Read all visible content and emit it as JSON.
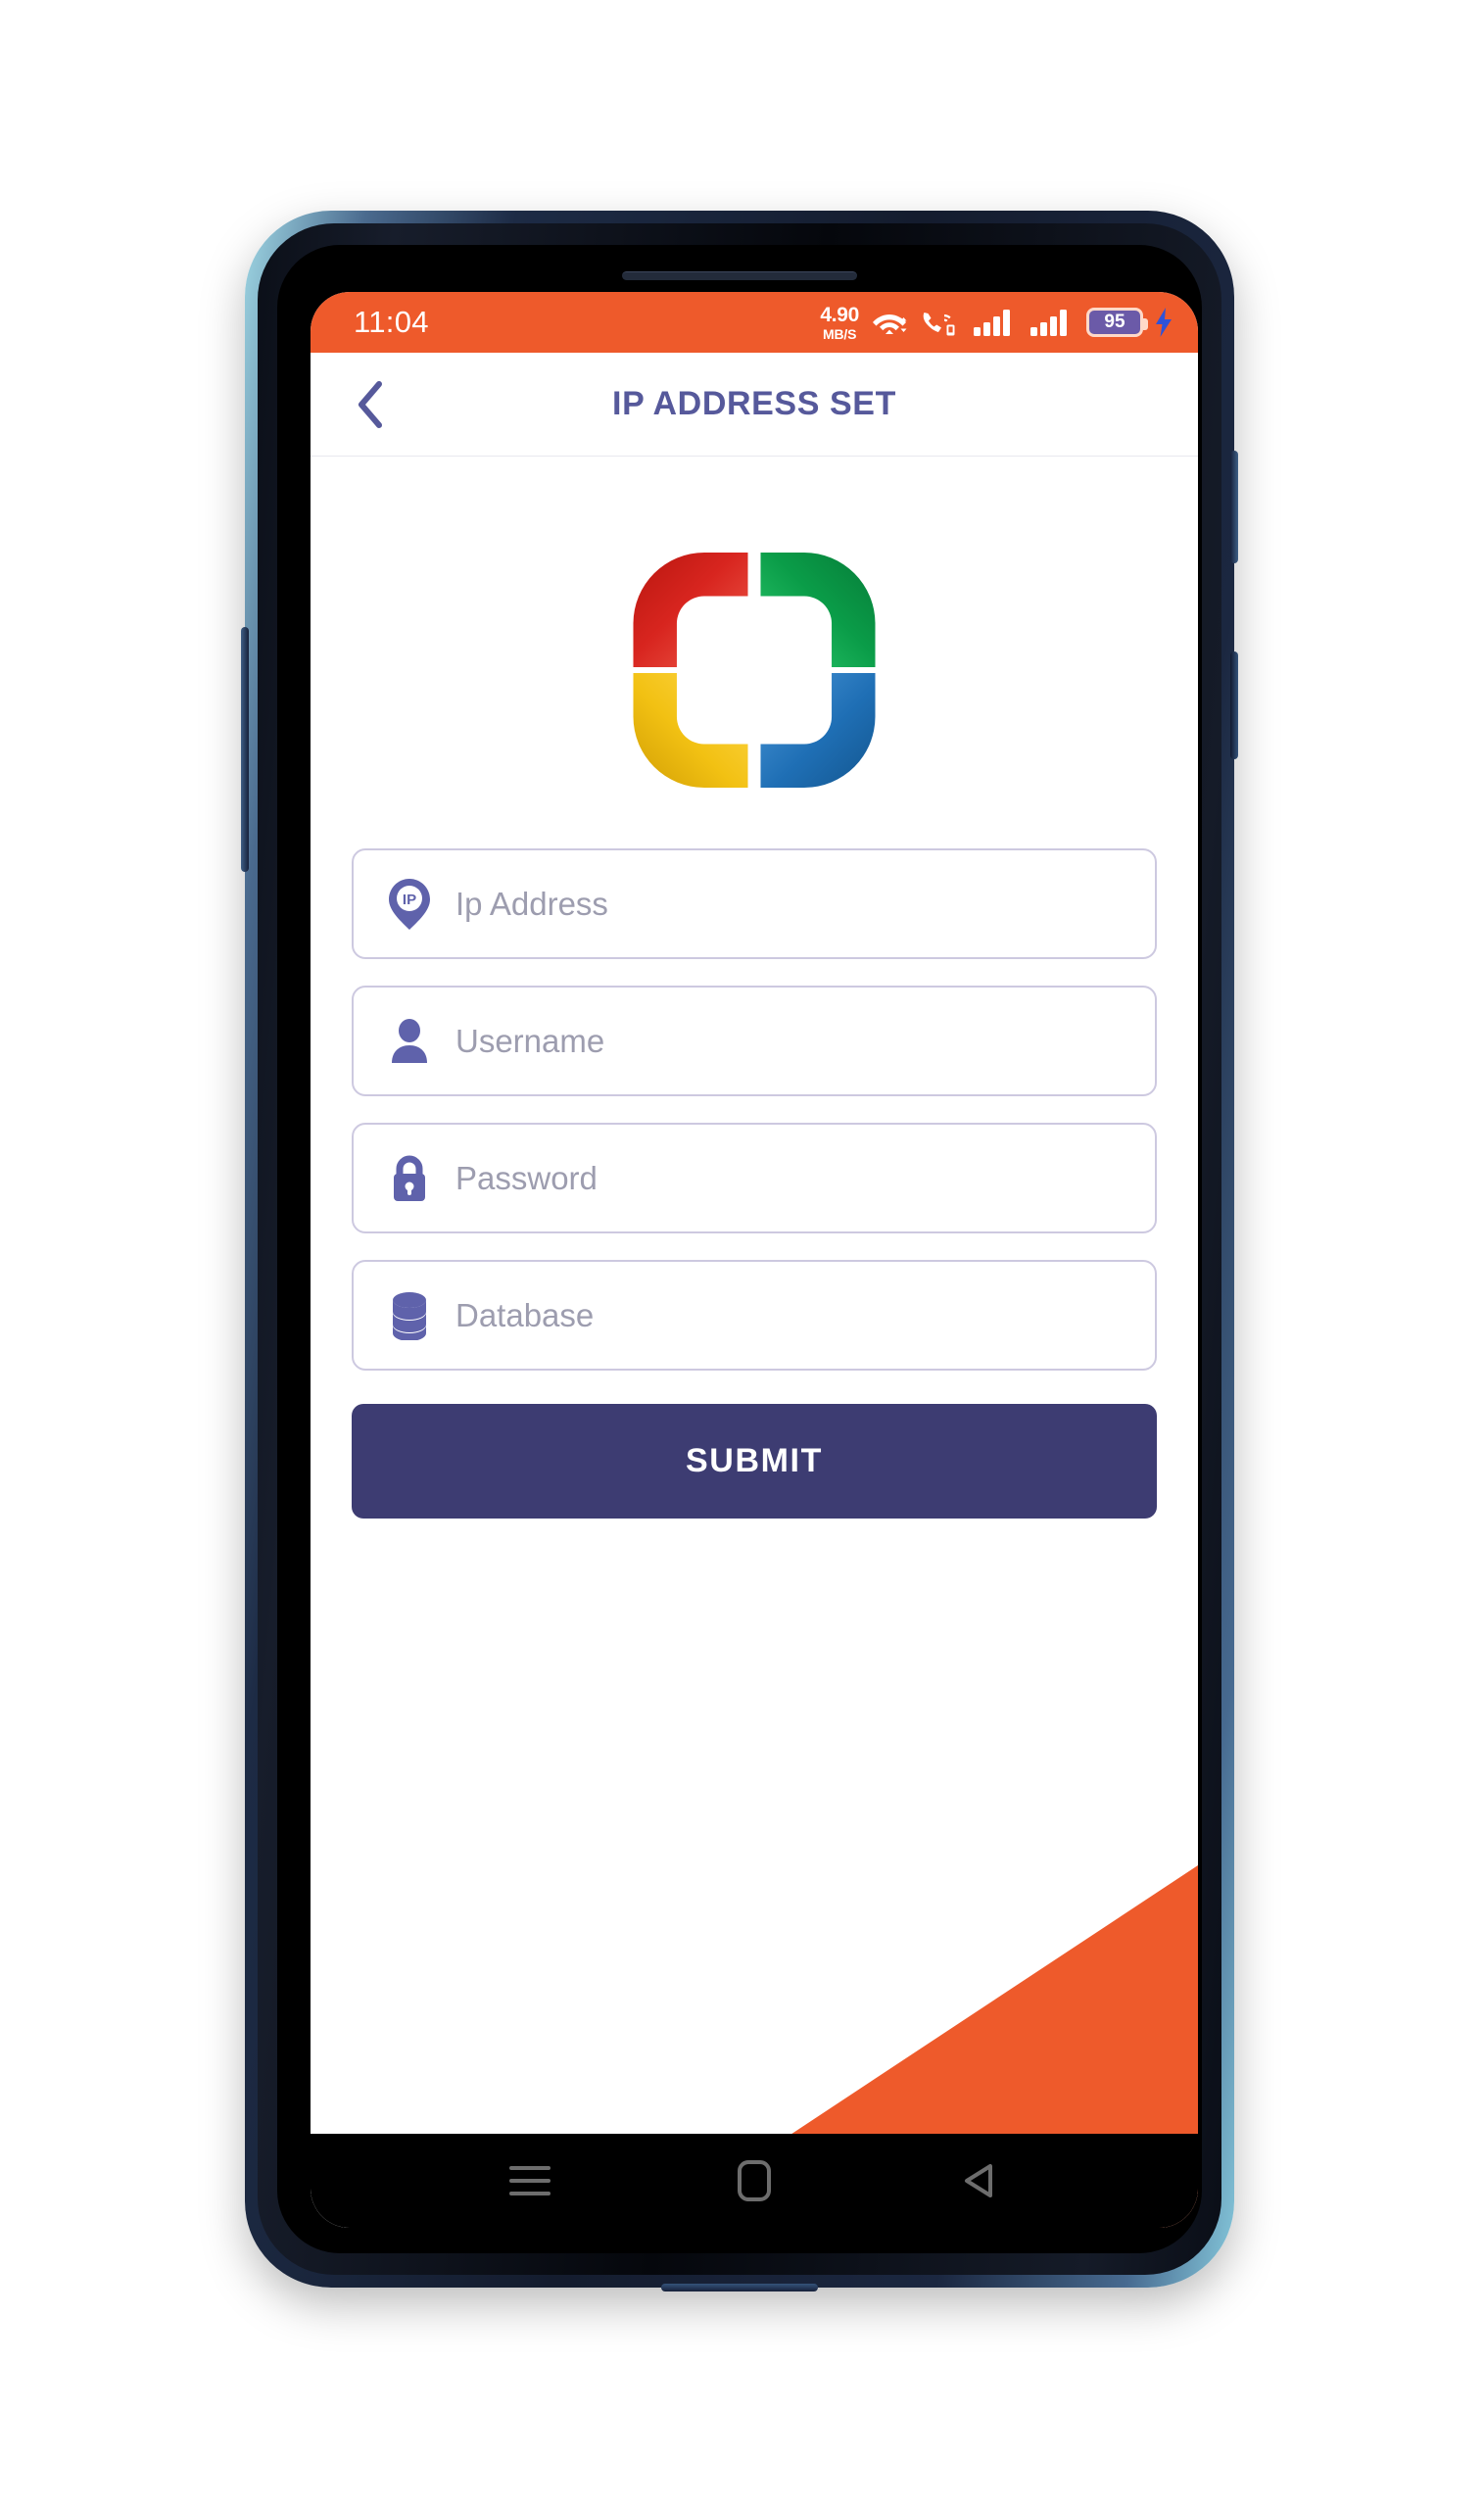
{
  "statusbar": {
    "time": "11:04",
    "network_speed_value": "4.90",
    "network_speed_unit": "MB/S",
    "wifi_icon": "wifi-icon",
    "volte_icon": "volte-call-icon",
    "signal_icon_1": "signal-bars-sim1-icon",
    "signal_icon_2": "signal-bars-sim2-icon",
    "battery_level": "95",
    "charging_icon": "charging-bolt-icon",
    "background_color": "#ee5a2b"
  },
  "appbar": {
    "back_icon": "back-chevron-icon",
    "title": "IP ADDRESS SET",
    "title_color": "#56599b"
  },
  "logo": {
    "name": "app-logo",
    "elbow_colors": {
      "top_left": "#e0302a",
      "top_right": "#0aa14b",
      "bottom_left": "#f5c518",
      "bottom_right": "#1f6fb5"
    }
  },
  "form": {
    "fields": [
      {
        "name": "ip-address",
        "icon": "ip-location-pin-icon",
        "placeholder": "Ip Address",
        "value": ""
      },
      {
        "name": "username",
        "icon": "person-icon",
        "placeholder": "Username",
        "value": ""
      },
      {
        "name": "password",
        "icon": "lock-icon",
        "placeholder": "Password",
        "value": ""
      },
      {
        "name": "database",
        "icon": "database-icon",
        "placeholder": "Database",
        "value": ""
      }
    ],
    "submit_label": "SUBMIT",
    "submit_color": "#3d3c72",
    "field_border_color": "#cdc9e0",
    "icon_color": "#5f62ab"
  },
  "decoration": {
    "corner_triangle_color": "#ee5a2b"
  },
  "navbar": {
    "recents_icon": "recents-menu-icon",
    "home_icon": "home-square-icon",
    "back_icon": "back-triangle-icon"
  }
}
